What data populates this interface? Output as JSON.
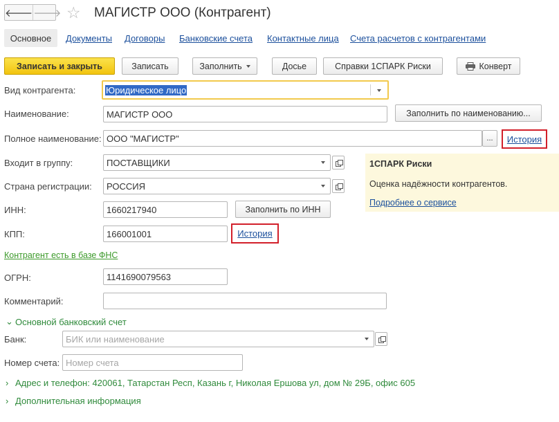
{
  "header": {
    "title": "МАГИСТР ООО (Контрагент)",
    "back_glyph": "🡐",
    "forward_glyph": "🡒",
    "star_glyph": "☆"
  },
  "tabs": {
    "active": "Основное",
    "links": [
      "Документы",
      "Договоры",
      "Банковские счета",
      "Контактные лица",
      "Счета расчетов с контрагентами"
    ]
  },
  "toolbar": {
    "save_close": "Записать и закрыть",
    "save": "Записать",
    "fill": "Заполнить",
    "dossier": "Досье",
    "spark": "Справки 1СПАРК Риски",
    "envelope": "Конверт"
  },
  "form": {
    "kind": {
      "label": "Вид контрагента:",
      "value": "Юридическое лицо"
    },
    "name": {
      "label": "Наименование:",
      "value": "МАГИСТР ООО",
      "fill_button": "Заполнить по наименованию..."
    },
    "full_name": {
      "label": "Полное наименование:",
      "value": "ООО \"МАГИСТР\"",
      "ellipsis": "...",
      "history": "История"
    },
    "group": {
      "label": "Входит в группу:",
      "value": "ПОСТАВЩИКИ"
    },
    "country": {
      "label": "Страна регистрации:",
      "value": "РОССИЯ"
    },
    "inn": {
      "label": "ИНН:",
      "value": "1660217940",
      "fill_button": "Заполнить по ИНН"
    },
    "kpp": {
      "label": "КПП:",
      "value": "166001001",
      "history": "История"
    },
    "fns_link": "Контрагент есть в базе ФНС",
    "ogrn": {
      "label": "ОГРН:",
      "value": "1141690079563"
    },
    "comment": {
      "label": "Комментарий:",
      "value": ""
    },
    "bank_section": "Основной банковский счет",
    "bank": {
      "label": "Банк:",
      "placeholder": "БИК или наименование"
    },
    "account": {
      "label": "Номер счета:",
      "placeholder": "Номер счета"
    },
    "address": "Адрес и телефон: 420061, Татарстан Респ, Казань г, Николая Ершова ул, дом № 29Б, офис 605",
    "additional": "Дополнительная информация"
  },
  "info_panel": {
    "title": "1СПАРК Риски",
    "text": "Оценка надёжности контрагентов.",
    "link": "Подробнее о сервисе"
  },
  "colors": {
    "primary_button": "#f2c40f",
    "link": "#1b4f9c",
    "green": "#2f8a3b",
    "highlight_box": "#d21f2a",
    "info_bg": "#fdf8dd"
  }
}
